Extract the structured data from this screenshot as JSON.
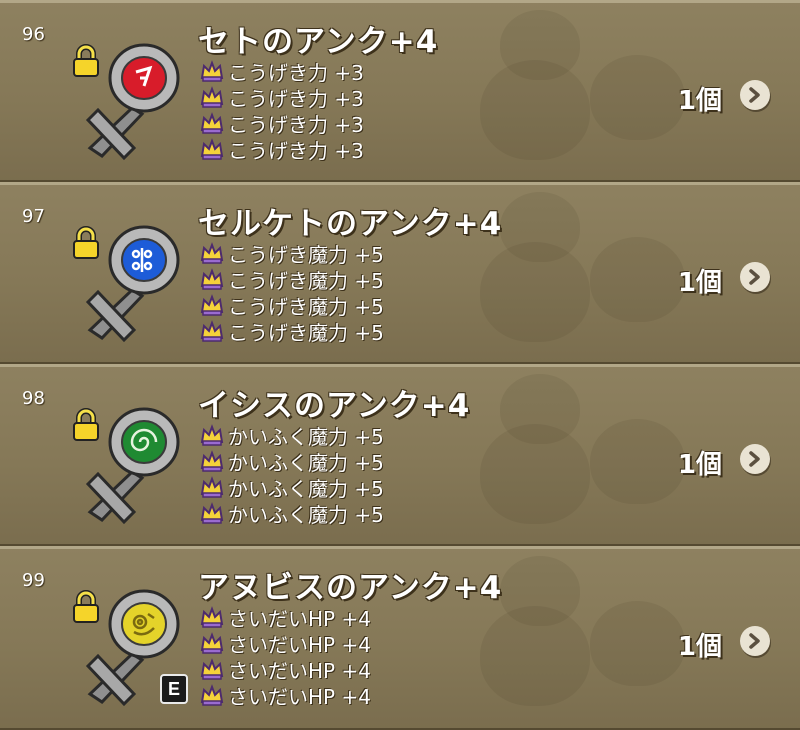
{
  "items": [
    {
      "index": "96",
      "name": "セトのアンク+4",
      "count": "1個",
      "gem_color": "#d81c2a",
      "glyph_color": "#ffffff",
      "equipped": false,
      "stats": [
        "こうげき力 +3",
        "こうげき力 +3",
        "こうげき力 +3",
        "こうげき力 +3"
      ]
    },
    {
      "index": "97",
      "name": "セルケトのアンク+4",
      "count": "1個",
      "gem_color": "#1d5cd8",
      "glyph_color": "#ffffff",
      "equipped": false,
      "stats": [
        "こうげき魔力 +5",
        "こうげき魔力 +5",
        "こうげき魔力 +5",
        "こうげき魔力 +5"
      ]
    },
    {
      "index": "98",
      "name": "イシスのアンク+4",
      "count": "1個",
      "gem_color": "#1f8a32",
      "glyph_color": "#e6f3df",
      "equipped": false,
      "stats": [
        "かいふく魔力 +5",
        "かいふく魔力 +5",
        "かいふく魔力 +5",
        "かいふく魔力 +5"
      ]
    },
    {
      "index": "99",
      "name": "アヌビスのアンク+4",
      "count": "1個",
      "gem_color": "#e4d32a",
      "glyph_color": "#7a6a10",
      "equipped": true,
      "equip_label": "E",
      "stats": [
        "さいだいHP +4",
        "さいだいHP +4",
        "さいだいHP +4",
        "さいだいHP +4"
      ]
    }
  ],
  "icons": {
    "lock": "lock-icon",
    "stat": "crown-icon",
    "arrow": "chevron-right-icon"
  }
}
